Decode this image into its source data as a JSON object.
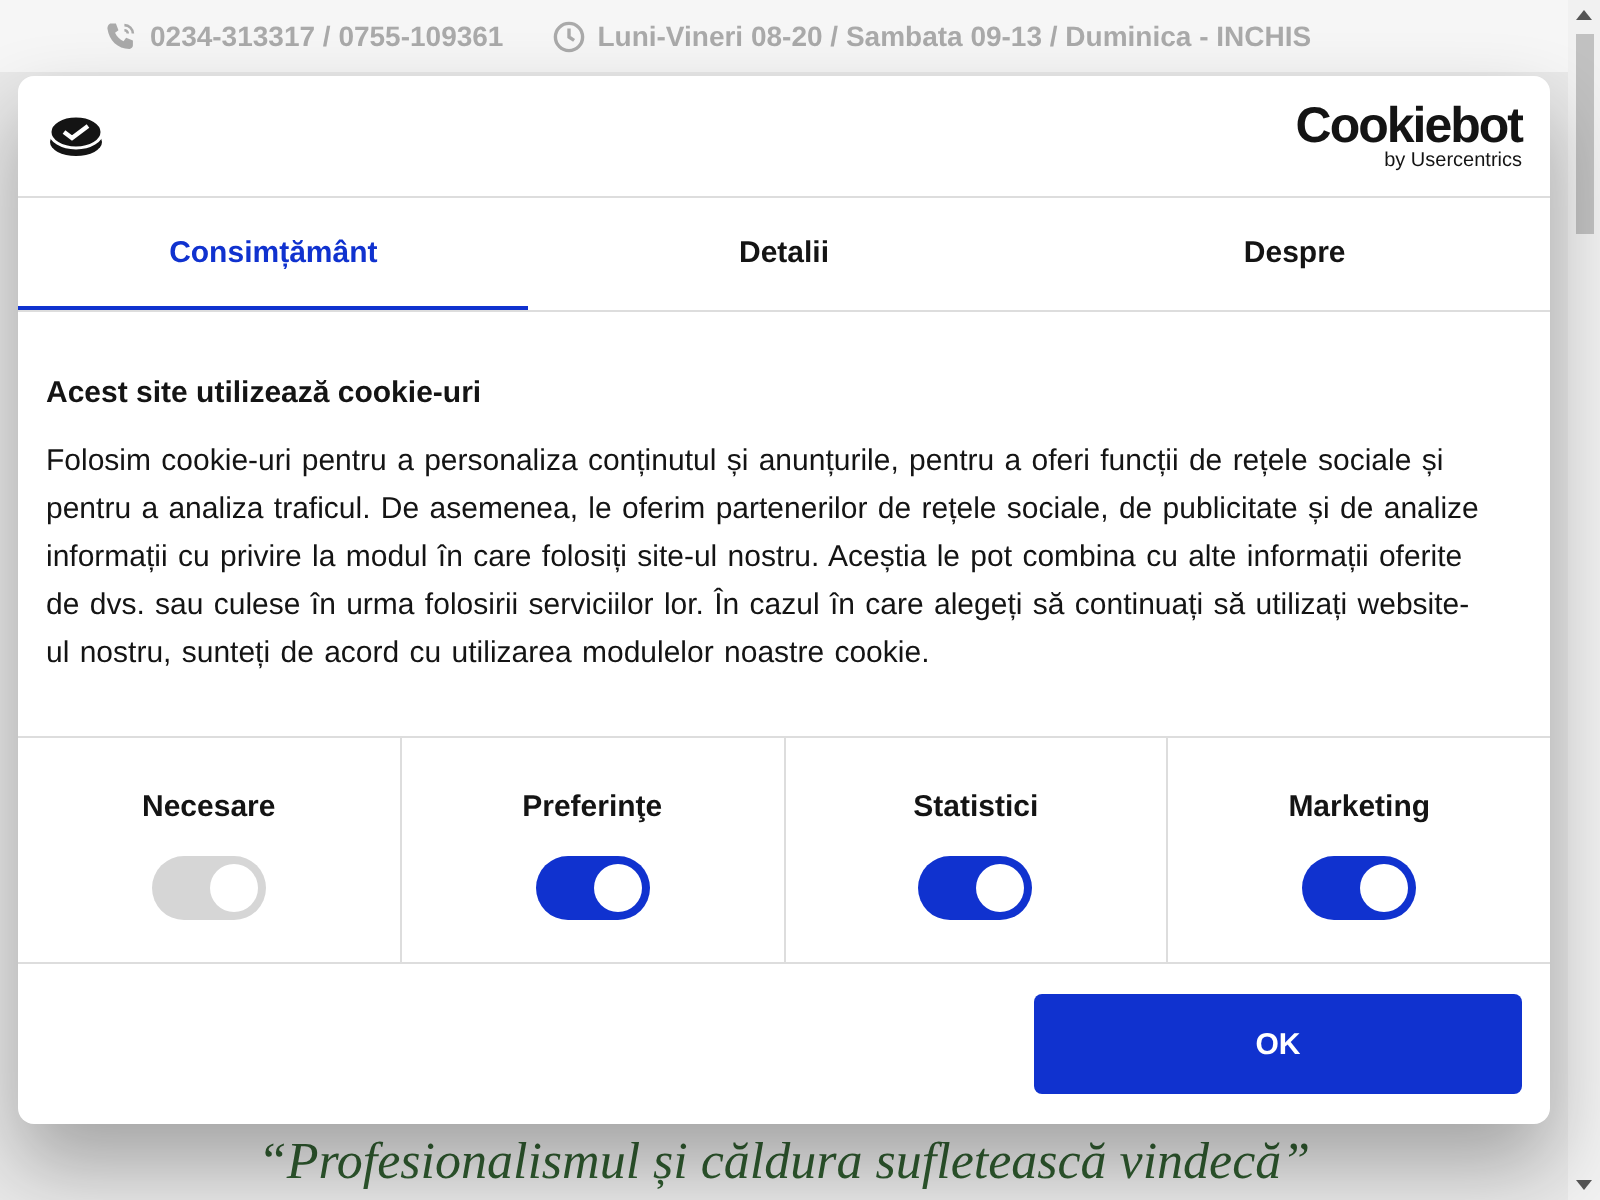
{
  "top_bar": {
    "phone": "0234-313317 / 0755-109361",
    "hours": "Luni-Vineri 08-20 / Sambata 09-13 / Duminica - INCHIS"
  },
  "dialog": {
    "brand": {
      "name": "Cookiebot",
      "tagline": "by Usercentrics"
    },
    "tabs": [
      {
        "label": "Consimțământ",
        "selected": true
      },
      {
        "label": "Detalii",
        "selected": false
      },
      {
        "label": "Despre",
        "selected": false
      }
    ],
    "title": "Acest site utilizează cookie-uri",
    "text": "Folosim cookie-uri pentru a personaliza conținutul și anunțurile, pentru a oferi funcții de rețele sociale și pentru a analiza traficul. De asemenea, le oferim partenerilor de rețele sociale, de publicitate și de analize informații cu privire la modul în care folosiți site-ul nostru. Aceștia le pot combina cu alte informații oferite de dvs. sau culese în urma folosirii serviciilor lor. În cazul în care alegeți să continuați să utilizați website-ul nostru, sunteți de acord cu utilizarea modulelor noastre cookie.",
    "toggles": [
      {
        "label": "Necesare",
        "on": true,
        "disabled": true
      },
      {
        "label": "Preferinţe",
        "on": true,
        "disabled": false
      },
      {
        "label": "Statistici",
        "on": true,
        "disabled": false
      },
      {
        "label": "Marketing",
        "on": true,
        "disabled": false
      }
    ],
    "button": "OK"
  },
  "quote": "“Profesionalismul și căldura sufletească vindecă”"
}
